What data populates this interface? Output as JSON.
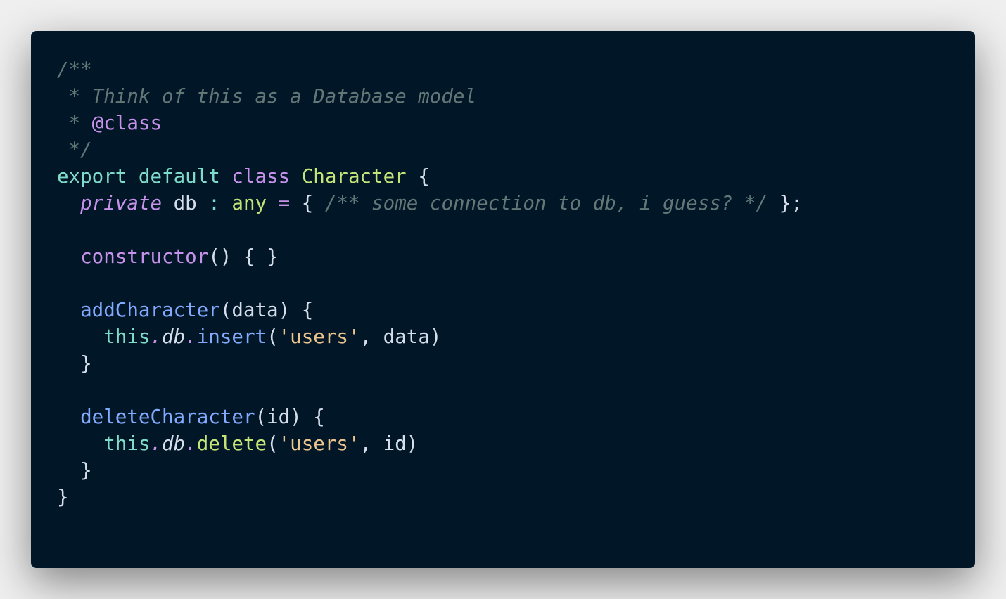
{
  "colors": {
    "background": "#011627",
    "page": "#efefef",
    "comment": "#637777",
    "keyword": "#7fdbca",
    "storage": "#c792ea",
    "className": "#ffcb8b",
    "type": "#c5e478",
    "function": "#82aaff",
    "string": "#ecc48d",
    "text": "#d6deeb"
  },
  "code": {
    "l1": {
      "comment": "/**"
    },
    "l2": {
      "comment": " * Think of this as a Database model"
    },
    "l3": {
      "star": " * ",
      "tag": "@class"
    },
    "l4": {
      "comment": " */"
    },
    "l5": {
      "export": "export",
      "default": "default",
      "class": "class",
      "name": "Character",
      "brace": "{"
    },
    "l6": {
      "indent": "  ",
      "private": "private",
      "field": "db",
      "colon": ":",
      "type": "any",
      "eq": "=",
      "open": "{",
      "comment": "/** some connection to db, i guess? */",
      "close": "};"
    },
    "l8": {
      "indent": "  ",
      "ctor": "constructor",
      "rest": "() { }"
    },
    "l10": {
      "indent": "  ",
      "fn": "addCharacter",
      "params": "(data) {"
    },
    "l11": {
      "indent": "    ",
      "this": "this",
      "dot1": ".",
      "db": "db",
      "dot2": ".",
      "method": "insert",
      "open": "(",
      "str": "'users'",
      "rest": ", data)"
    },
    "l12": {
      "text": "  }"
    },
    "l14": {
      "indent": "  ",
      "fn": "deleteCharacter",
      "params": "(id) {"
    },
    "l15": {
      "indent": "    ",
      "this": "this",
      "dot1": ".",
      "db": "db",
      "dot2": ".",
      "method": "delete",
      "open": "(",
      "str": "'users'",
      "rest": ", id)"
    },
    "l16": {
      "text": "  }"
    },
    "l17": {
      "text": "}"
    }
  }
}
